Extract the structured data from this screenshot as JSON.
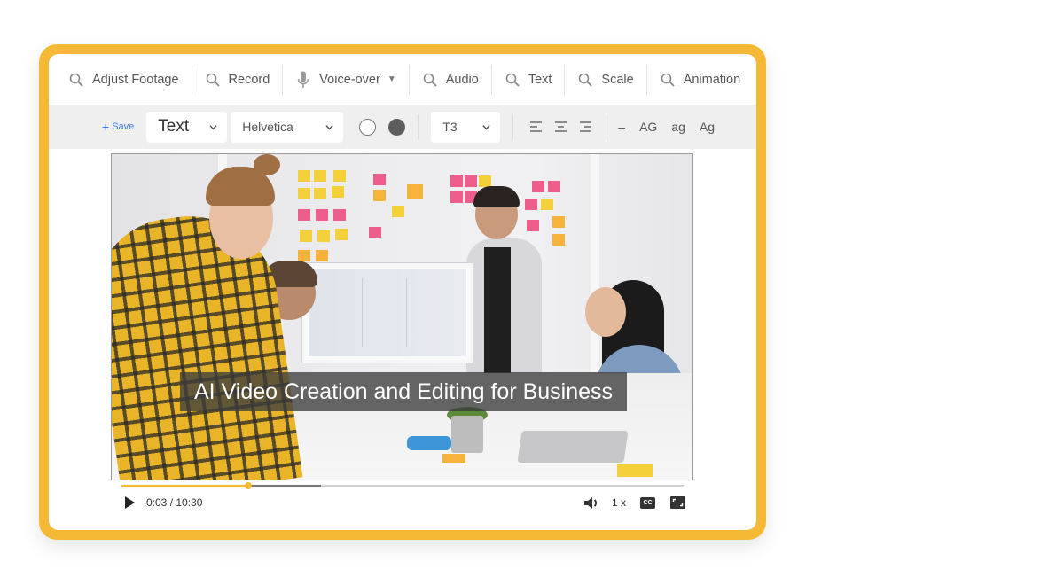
{
  "toolbar": {
    "items": [
      {
        "label": "Adjust Footage",
        "icon": "search-icon"
      },
      {
        "label": "Record",
        "icon": "search-icon"
      },
      {
        "label": "Voice-over",
        "icon": "microphone-icon",
        "has_dropdown": true
      },
      {
        "label": "Audio",
        "icon": "search-icon"
      },
      {
        "label": "Text",
        "icon": "search-icon"
      },
      {
        "label": "Scale",
        "icon": "search-icon"
      },
      {
        "label": "Animation",
        "icon": "search-icon"
      }
    ]
  },
  "format_bar": {
    "save_label": "Save",
    "save_prefix": "+",
    "style_select": "Text",
    "font_select": "Helvetica",
    "color_options": [
      "#ffffff",
      "#5d5d5d"
    ],
    "size_select": "T3",
    "align_buttons": [
      "align-left",
      "align-center",
      "align-right"
    ],
    "case_buttons": {
      "dash": "–",
      "upper": "AG",
      "lower": "ag",
      "title": "Ag"
    }
  },
  "video": {
    "caption": "AI Video Creation and Editing for Business",
    "current_time": "0:03",
    "duration": "10:30",
    "time_display": "0:03 / 10:30",
    "played_fraction": 0.225,
    "buffered_fraction": 0.355,
    "speed": "1 x",
    "cc_label": "CC"
  },
  "colors": {
    "frame": "#F5B935",
    "accent_link": "#3b7be0",
    "progress_played": "#F5B935"
  }
}
